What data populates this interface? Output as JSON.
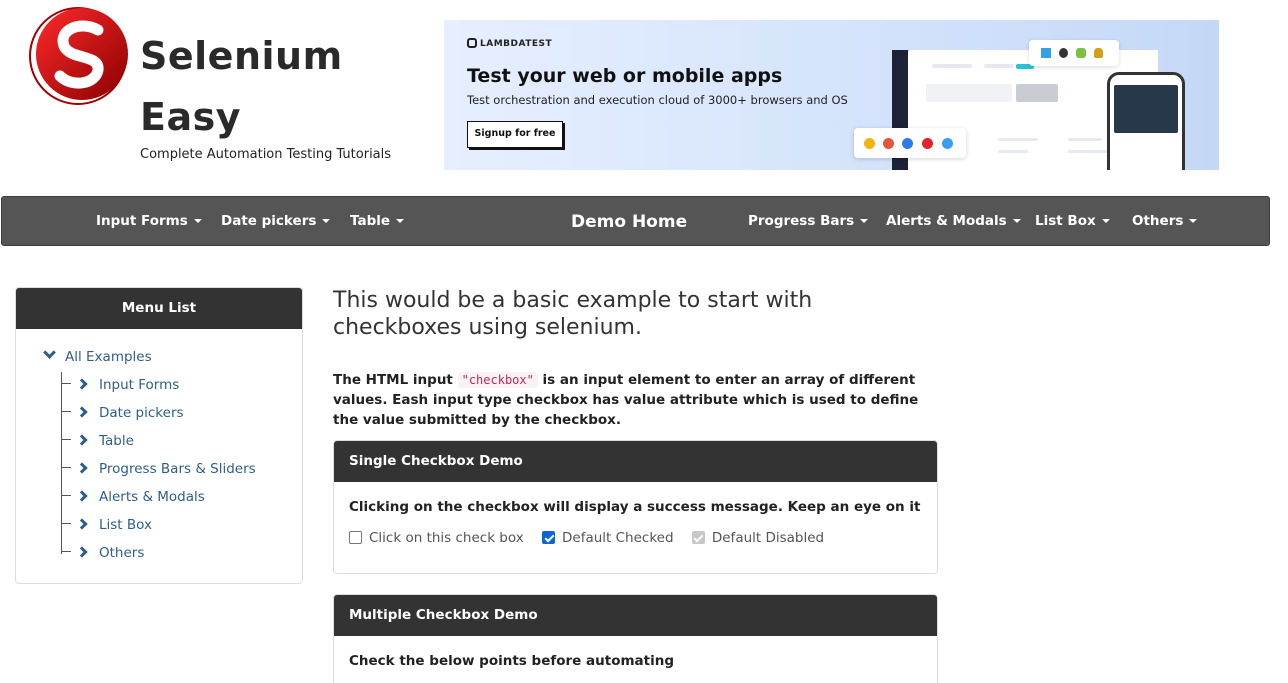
{
  "header": {
    "brand_line1": "Selenium",
    "brand_line2": "Easy",
    "tagline": "Complete Automation Testing Tutorials"
  },
  "banner": {
    "logo_text": "LAMBDATEST",
    "title": "Test your web or mobile apps",
    "subtitle": "Test orchestration and execution cloud of 3000+ browsers and OS",
    "button": "Signup for free"
  },
  "nav": {
    "items_left": [
      "Input Forms",
      "Date pickers",
      "Table"
    ],
    "brand": "Demo Home",
    "items_right": [
      "Progress Bars",
      "Alerts & Modals",
      "List Box",
      "Others"
    ]
  },
  "sidebar": {
    "title": "Menu List",
    "root": "All Examples",
    "items": [
      "Input Forms",
      "Date pickers",
      "Table",
      "Progress Bars & Sliders",
      "Alerts & Modals",
      "List Box",
      "Others"
    ]
  },
  "main": {
    "heading": "This would be a basic example to start with checkboxes using selenium.",
    "intro_before": "The HTML input ",
    "intro_code": "\"checkbox\"",
    "intro_after": " is an input element to enter an array of different values. Eash input type checkbox has value attribute which is used to define the value submitted by the checkbox.",
    "single": {
      "title": "Single Checkbox Demo",
      "text": "Clicking on the checkbox will display a success message. Keep an eye on it",
      "checkboxes": [
        {
          "label": "Click on this check box",
          "checked": false,
          "disabled": false
        },
        {
          "label": "Default Checked",
          "checked": true,
          "disabled": false
        },
        {
          "label": "Default Disabled",
          "checked": true,
          "disabled": true
        }
      ]
    },
    "multiple": {
      "title": "Multiple Checkbox Demo",
      "text": "Check the below points before automating"
    }
  },
  "colors": {
    "nav_bg": "#555555",
    "panel_head_bg": "#333333",
    "link": "#2f5e8a",
    "checkbox_checked": "#0b67d6"
  }
}
